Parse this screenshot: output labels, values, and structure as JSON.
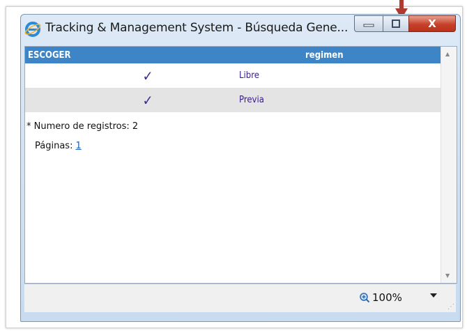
{
  "window": {
    "title": "Tracking & Management System - Búsqueda Gene...",
    "close_label": "X"
  },
  "table": {
    "headers": [
      "ESCOGER",
      "regimen"
    ],
    "rows": [
      {
        "check": "✓",
        "regimen": "Libre"
      },
      {
        "check": "✓",
        "regimen": "Previa"
      }
    ]
  },
  "records": {
    "label": "* Numero de registros: 2",
    "pages_label": "Páginas:",
    "page_link": "1"
  },
  "statusbar": {
    "zoom": "100%"
  },
  "colors": {
    "header_bg": "#3d85c6",
    "alt_row": "#e4e4e4",
    "close_button": "#c7402a",
    "annotation_arrow": "#b03a2e"
  }
}
